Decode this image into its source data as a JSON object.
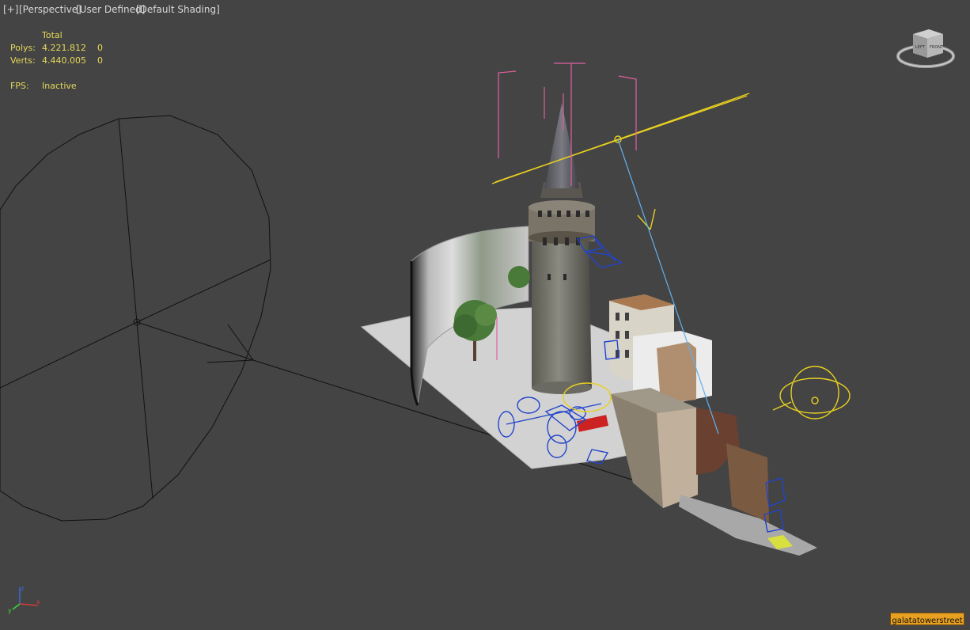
{
  "viewport": {
    "menu_plus": "[+]",
    "view_type": "[Perspective]",
    "view_mode": "[User Defined]",
    "shading": "[Default Shading]"
  },
  "stats": {
    "header": "Total",
    "polys_label": "Polys:",
    "polys_total": "4.221.812",
    "polys_selected": "0",
    "verts_label": "Verts:",
    "verts_total": "4.440.005",
    "verts_selected": "0",
    "fps_label": "FPS:",
    "fps_value": "Inactive"
  },
  "viewcube": {
    "left_face": "LEFT",
    "front_face": "FRONT"
  },
  "axis": {
    "x": "x",
    "y": "y",
    "z": "z"
  },
  "track_bar": {
    "label": "galatatowerstreet"
  },
  "colors": {
    "background": "#444444",
    "stats_text": "#e6d85a",
    "light_gizmo": "#e8d020",
    "target_line": "#60b0f0",
    "camera_gizmo": "#2244cc",
    "bounds_gizmo": "#e060a0",
    "tag_bg": "#e8a020"
  }
}
